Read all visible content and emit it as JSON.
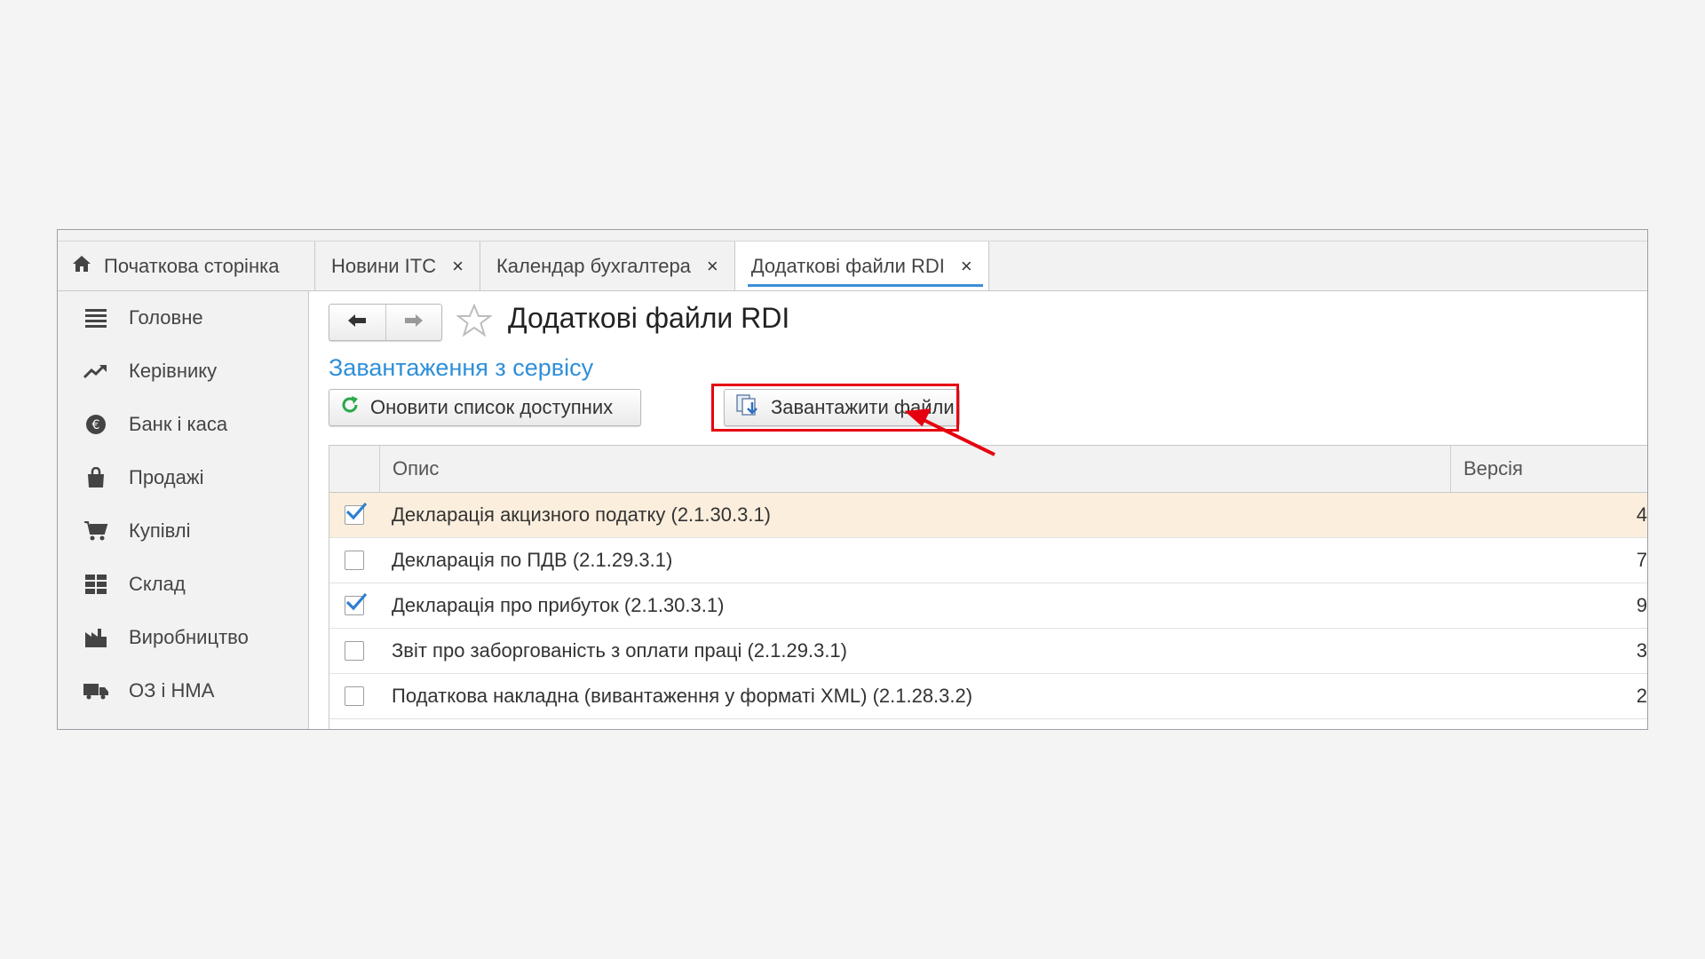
{
  "tabs": {
    "home": "Початкова сторінка",
    "items": [
      {
        "label": "Новини ІТС"
      },
      {
        "label": "Календар бухгалтера"
      },
      {
        "label": "Додаткові файли RDI"
      }
    ],
    "close_glyph": "×"
  },
  "sidebar": {
    "items": [
      {
        "label": "Головне",
        "icon": "menu-icon"
      },
      {
        "label": "Керівнику",
        "icon": "trend-icon"
      },
      {
        "label": "Банк і каса",
        "icon": "coin-icon"
      },
      {
        "label": "Продажі",
        "icon": "bag-icon"
      },
      {
        "label": "Купівлі",
        "icon": "cart-icon"
      },
      {
        "label": "Склад",
        "icon": "grid-icon"
      },
      {
        "label": "Виробництво",
        "icon": "factory-icon"
      },
      {
        "label": "ОЗ і НМА",
        "icon": "truck-icon"
      }
    ]
  },
  "page": {
    "title": "Додаткові файли RDI",
    "section_link": "Завантаження з сервісу"
  },
  "toolbar": {
    "refresh_label": "Оновити список доступних",
    "load_label": "Завантажити файли"
  },
  "table": {
    "headers": {
      "desc": "Опис",
      "version": "Версія"
    },
    "rows": [
      {
        "checked": true,
        "desc": "Декларація акцизного податку (2.1.30.3.1)",
        "version": "4"
      },
      {
        "checked": false,
        "desc": "Декларація по ПДВ (2.1.29.3.1)",
        "version": "7"
      },
      {
        "checked": true,
        "desc": "Декларація про прибуток (2.1.30.3.1)",
        "version": "9"
      },
      {
        "checked": false,
        "desc": "Звіт про заборгованість з оплати праці (2.1.29.3.1)",
        "version": "3"
      },
      {
        "checked": false,
        "desc": "Податкова накладна (вивантаження у форматі XML) (2.1.28.3.2)",
        "version": "2"
      }
    ]
  },
  "colors": {
    "accent": "#2f8fd8",
    "highlight": "#e6000f",
    "selected_row": "#fbeedd",
    "refresh_icon": "#2aa84a"
  }
}
